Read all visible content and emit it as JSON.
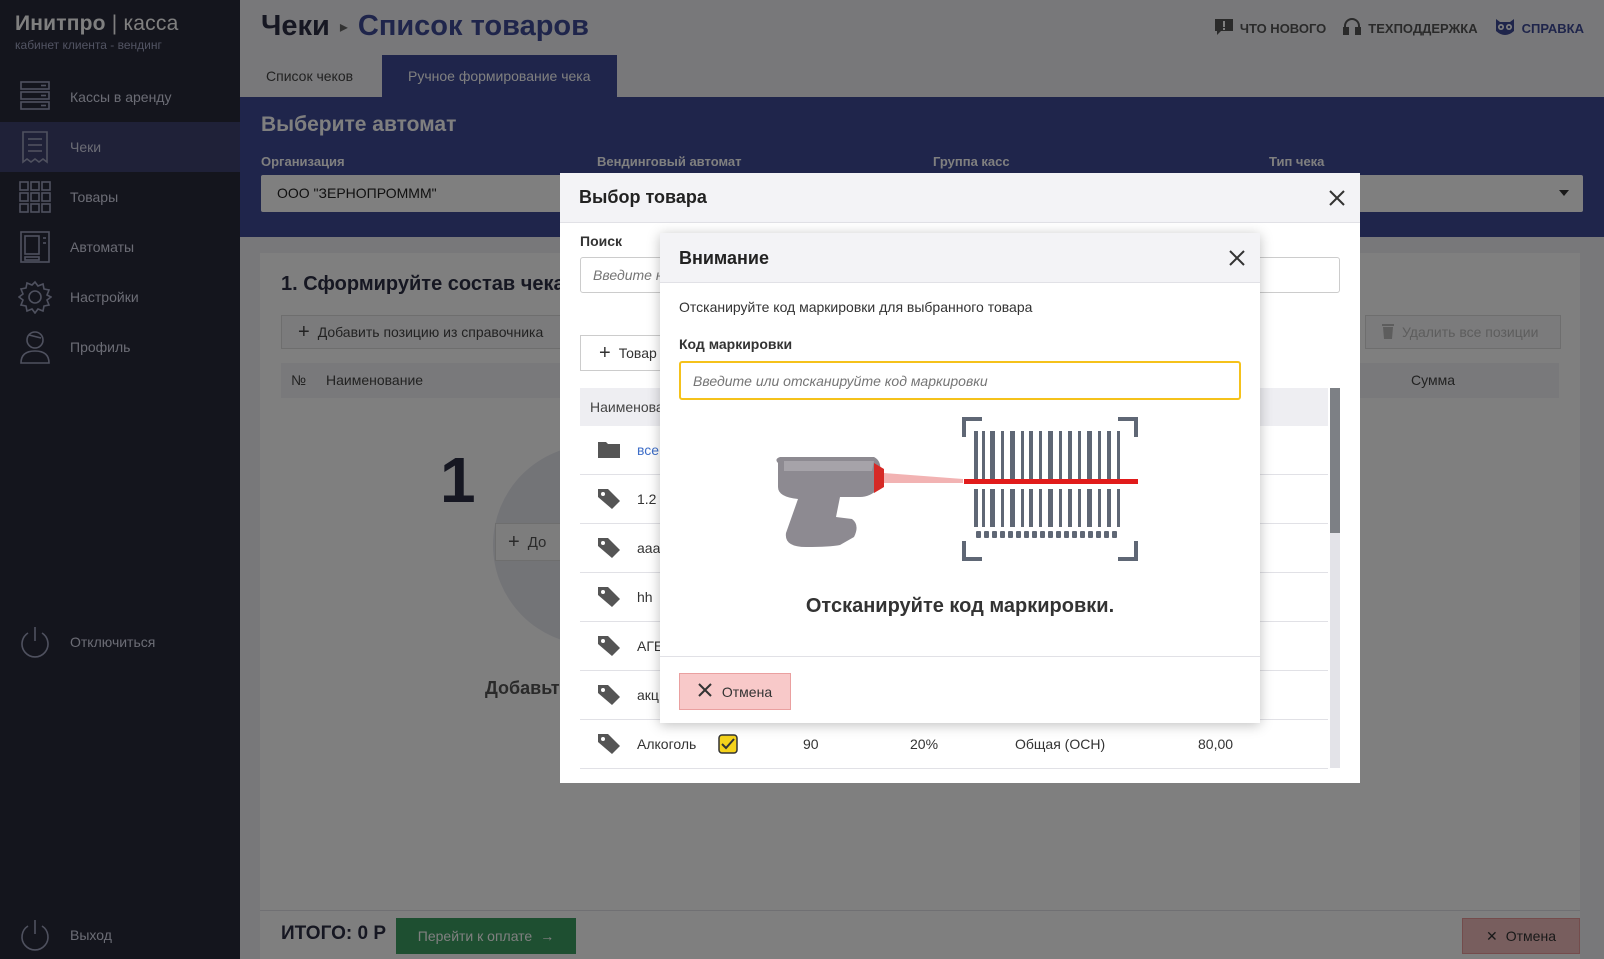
{
  "brand": {
    "title_bold": "Инитпро",
    "title_sep": " | ",
    "title_light": "касса",
    "subtitle": "кабинет клиента - вендинг"
  },
  "sidebar": {
    "items": [
      {
        "label": "Кассы в аренду",
        "icon": "server-icon"
      },
      {
        "label": "Чеки",
        "icon": "receipt-icon"
      },
      {
        "label": "Товары",
        "icon": "grid-icon"
      },
      {
        "label": "Автоматы",
        "icon": "vending-machine-icon"
      },
      {
        "label": "Настройки",
        "icon": "gear-icon"
      },
      {
        "label": "Профиль",
        "icon": "user-icon"
      }
    ],
    "disconnect": "Отключиться",
    "logout": "Выход"
  },
  "header": {
    "crumb_root": "Чеки",
    "crumb_current": "Список товаров",
    "links": {
      "news": "ЧТО НОВОГО",
      "support": "ТЕХПОДДЕРЖКА",
      "help": "СПРАВКА"
    }
  },
  "tabs": [
    {
      "label": "Список чеков"
    },
    {
      "label": "Ручное формирование чека"
    }
  ],
  "banner": {
    "title": "Выберите автомат",
    "labels": {
      "org": "Организация",
      "machine": "Вендинговый автомат",
      "group": "Группа касс",
      "type": "Тип чека"
    },
    "org_value": "ООО \"ЗЕРНОПРОММM\""
  },
  "content": {
    "step_title": "1. Сформируйте состав чека",
    "add_from_catalog": "Добавить позицию из справочника",
    "delete_all": "Удалить все позиции",
    "col_num": "№",
    "col_name": "Наименование",
    "col_sum": "Сумма",
    "big_number": "1",
    "empty_text": "Добавьте",
    "empty_add": "До"
  },
  "footer": {
    "total": "ИТОГО: 0 Р",
    "pay": "Перейти к оплате",
    "cancel": "Отмена"
  },
  "product_modal": {
    "title": "Выбор товара",
    "search_label": "Поиск",
    "search_placeholder": "Введите н",
    "add_button": "Товар",
    "col_name": "Наименова",
    "rows": [
      {
        "name": "все",
        "icon": "folder-icon",
        "link": true
      },
      {
        "name": "1.2",
        "icon": "tag-icon"
      },
      {
        "name": "aaa",
        "icon": "tag-icon"
      },
      {
        "name": "hh",
        "icon": "tag-icon"
      },
      {
        "name": "АГЕ",
        "icon": "tag-icon"
      },
      {
        "name": "акц",
        "icon": "tag-icon"
      },
      {
        "name": "Алкоголь",
        "icon": "tag-icon",
        "qty": "90",
        "vat": "20%",
        "tax": "Общая (ОСН)",
        "price": "80,00"
      }
    ]
  },
  "attention_modal": {
    "title": "Внимание",
    "description": "Отсканируйте код маркировки для выбранного товара",
    "field_label": "Код маркировки",
    "field_placeholder": "Введите или отсканируйте код маркировки",
    "caption": "Отсканируйте код маркировки.",
    "cancel": "Отмена"
  },
  "colors": {
    "accent": "#3e4a96",
    "sidebar": "#292b3a",
    "input_focus": "#f5c21b",
    "cancel_bg": "#f8c9c9",
    "pay": "#3c9f63"
  }
}
